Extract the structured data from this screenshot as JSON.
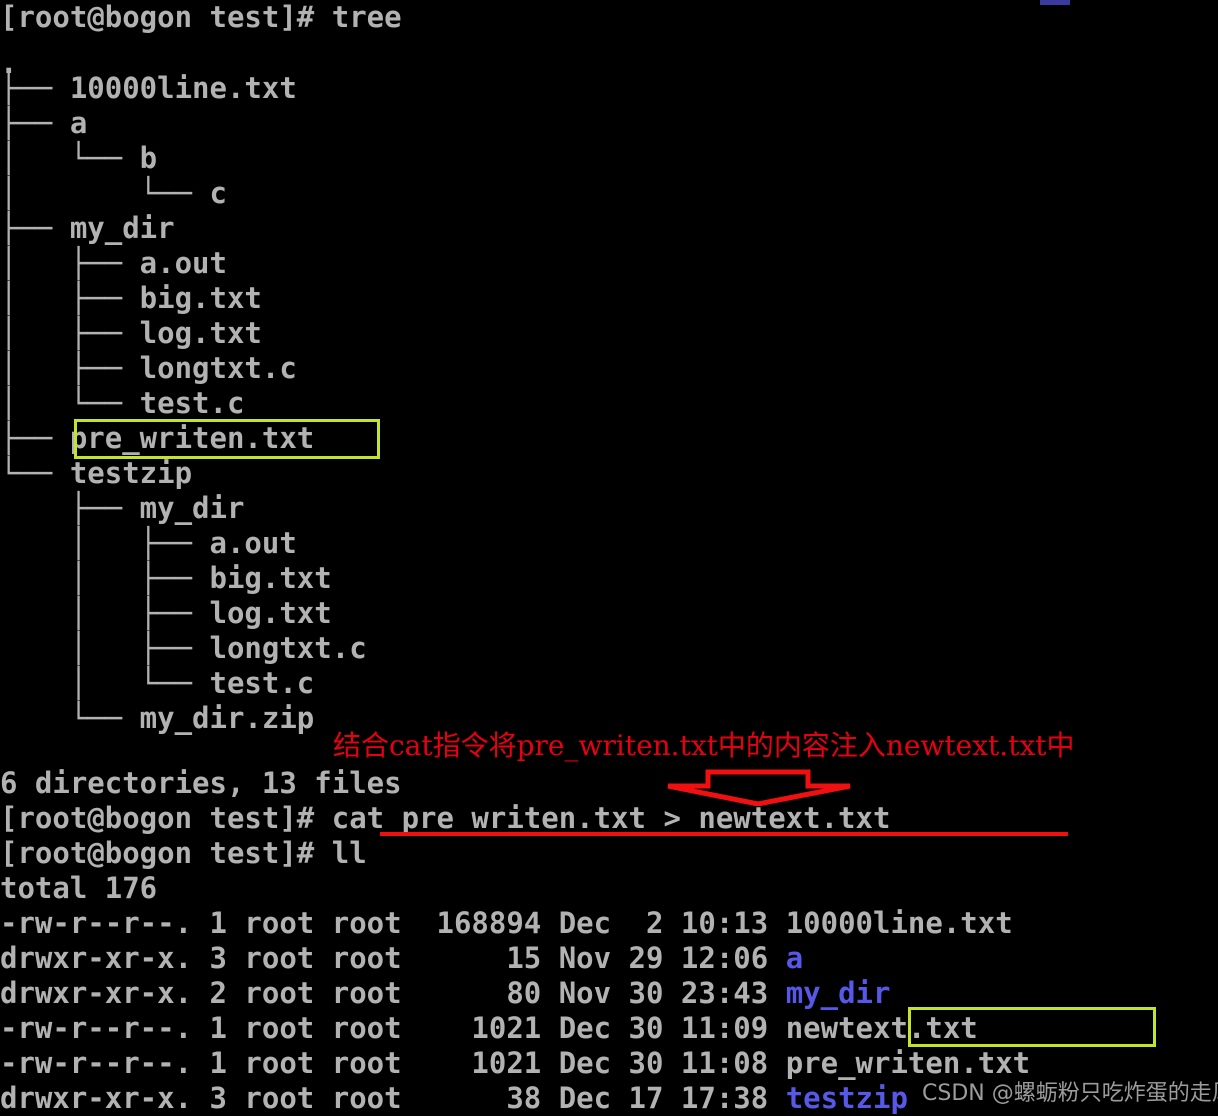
{
  "terminal": {
    "prompt": "[root@bogon test]# ",
    "background_color": "#000000",
    "text_color": "#b2b2b2",
    "dir_color": "#5858e8",
    "commands": {
      "tree": "tree",
      "cat_redirect": "cat pre_writen.txt > newtext.txt",
      "ll": "ll"
    },
    "lines": [
      {
        "id": "l0",
        "text": "[root@bogon test]# tree"
      },
      {
        "id": "l1",
        "text": "."
      },
      {
        "id": "l2",
        "text": "├── 10000line.txt"
      },
      {
        "id": "l3",
        "text": "├── a"
      },
      {
        "id": "l4",
        "text": "│   └── b"
      },
      {
        "id": "l5",
        "text": "│       └── c"
      },
      {
        "id": "l6",
        "text": "├── my_dir"
      },
      {
        "id": "l7",
        "text": "│   ├── a.out"
      },
      {
        "id": "l8",
        "text": "│   ├── big.txt"
      },
      {
        "id": "l9",
        "text": "│   ├── log.txt"
      },
      {
        "id": "l10",
        "text": "│   ├── longtxt.c"
      },
      {
        "id": "l11",
        "text": "│   └── test.c"
      },
      {
        "id": "l12",
        "text": "├── pre_writen.txt"
      },
      {
        "id": "l13",
        "text": "└── testzip"
      },
      {
        "id": "l14",
        "text": "    ├── my_dir"
      },
      {
        "id": "l15",
        "text": "    │   ├── a.out"
      },
      {
        "id": "l16",
        "text": "    │   ├── big.txt"
      },
      {
        "id": "l17",
        "text": "    │   ├── log.txt"
      },
      {
        "id": "l18",
        "text": "    │   ├── longtxt.c"
      },
      {
        "id": "l19",
        "text": "    │   └── test.c"
      },
      {
        "id": "l20",
        "text": "    └── my_dir.zip"
      },
      {
        "id": "l21",
        "text": ""
      },
      {
        "id": "l22",
        "text": "6 directories, 13 files"
      },
      {
        "id": "l23",
        "text": "[root@bogon test]# cat pre_writen.txt > newtext.txt"
      },
      {
        "id": "l24",
        "text": "[root@bogon test]# ll"
      },
      {
        "id": "l25",
        "text": "total 176"
      }
    ],
    "listing": {
      "total_label": "total 176",
      "rows": [
        {
          "perms": "-rw-r--r--.",
          "links": "1",
          "owner": "root",
          "group": "root",
          "size": "168894",
          "month": "Dec",
          "day": "2",
          "time": "10:13",
          "name": "10000line.txt",
          "is_dir": false
        },
        {
          "perms": "drwxr-xr-x.",
          "links": "3",
          "owner": "root",
          "group": "root",
          "size": "15",
          "month": "Nov",
          "day": "29",
          "time": "12:06",
          "name": "a",
          "is_dir": true
        },
        {
          "perms": "drwxr-xr-x.",
          "links": "2",
          "owner": "root",
          "group": "root",
          "size": "80",
          "month": "Nov",
          "day": "30",
          "time": "23:43",
          "name": "my_dir",
          "is_dir": true
        },
        {
          "perms": "-rw-r--r--.",
          "links": "1",
          "owner": "root",
          "group": "root",
          "size": "1021",
          "month": "Dec",
          "day": "30",
          "time": "11:09",
          "name": "newtext.txt",
          "is_dir": false
        },
        {
          "perms": "-rw-r--r--.",
          "links": "1",
          "owner": "root",
          "group": "root",
          "size": "1021",
          "month": "Dec",
          "day": "30",
          "time": "11:08",
          "name": "pre_writen.txt",
          "is_dir": false
        },
        {
          "perms": "drwxr-xr-x.",
          "links": "3",
          "owner": "root",
          "group": "root",
          "size": "38",
          "month": "Dec",
          "day": "17",
          "time": "17:38",
          "name": "testzip",
          "is_dir": true
        }
      ]
    }
  },
  "annotations": {
    "note_text": "结合cat指令将pre_writen.txt中的内容注入newtext.txt中",
    "note_color": "#e60012",
    "arrow_color": "#f01010",
    "highlight_color": "#c4e32c",
    "underline_color": "#f01010",
    "highlighted_items": [
      "pre_writen.txt",
      "newtext.txt"
    ]
  },
  "watermark": {
    "text": "CSDN @螺蛎粉只吃炸蛋的走风"
  }
}
